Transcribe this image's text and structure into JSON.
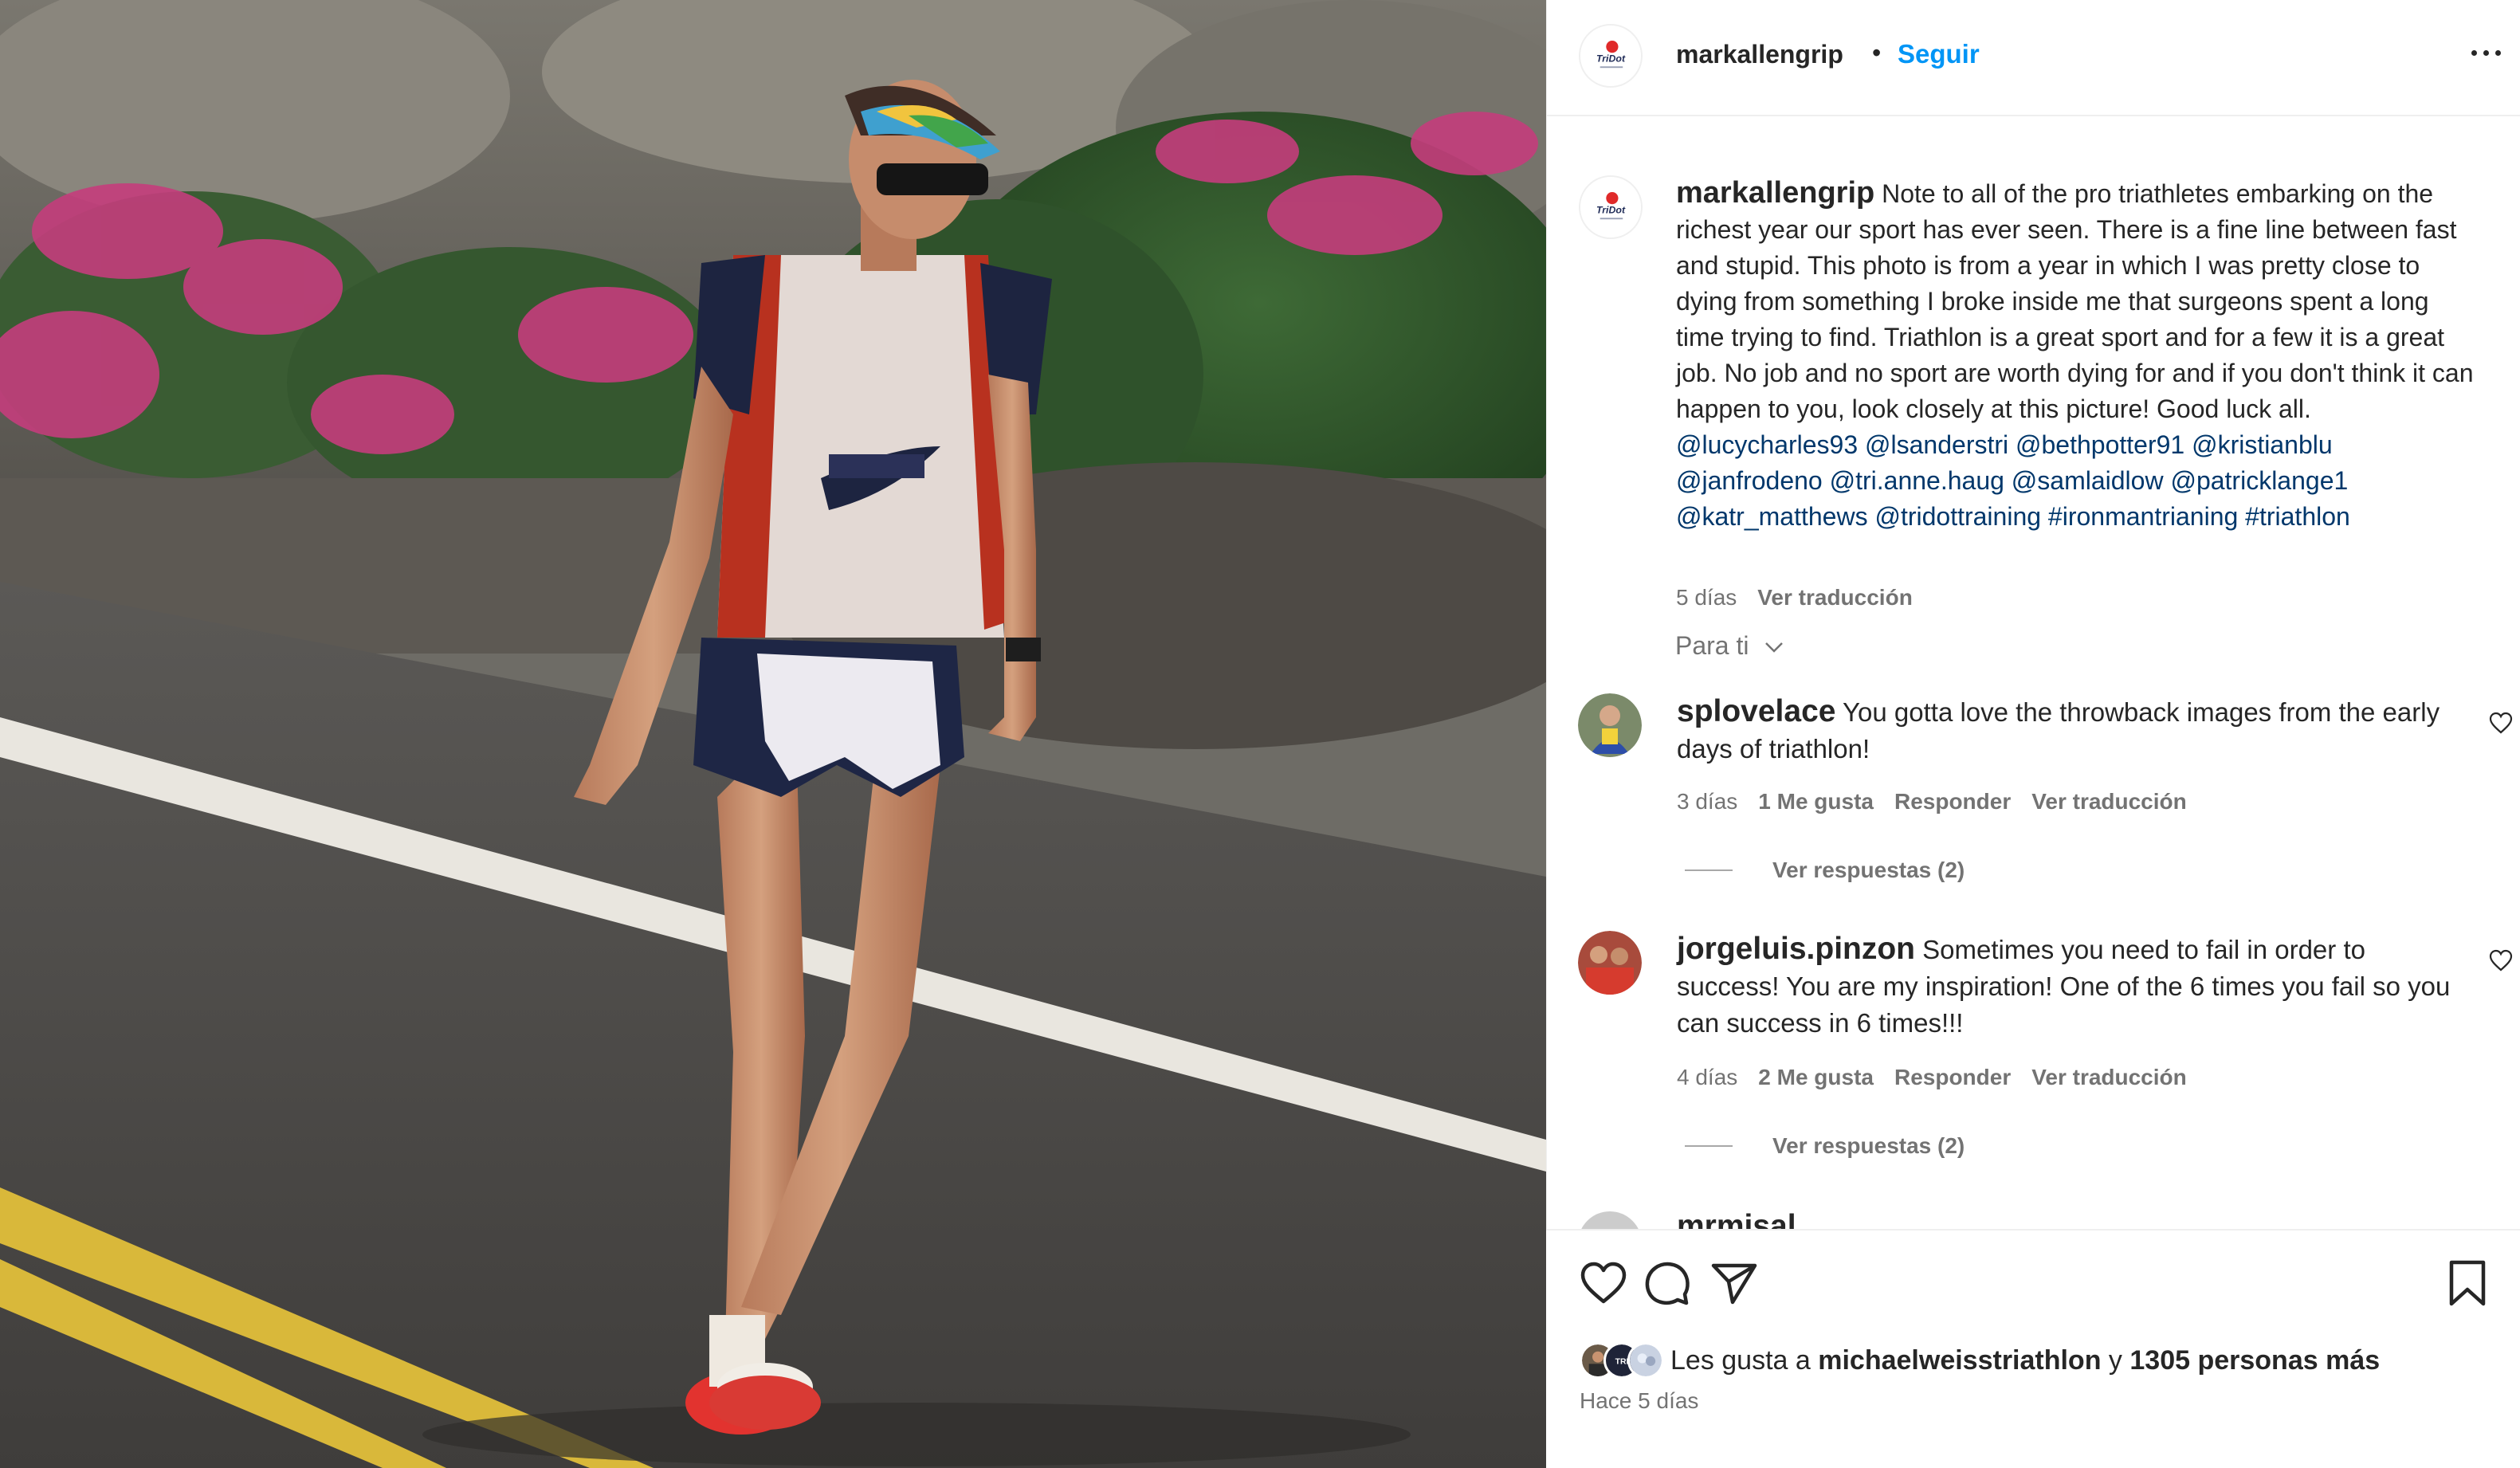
{
  "post": {
    "author": "markallengrip",
    "separator": "•",
    "follow_label": "Seguir",
    "more_icon": "more-horizontal-icon",
    "photo_description_icon": "triathlon-photo",
    "avatar_logo_text": "TriDot"
  },
  "caption": {
    "author": "markallengrip",
    "text": " Note to all of the pro triathletes embarking on the richest year our sport has ever seen. There is a fine line between fast and stupid. This photo is from a year in which I was pretty close to dying from something I broke inside me that surgeons spent a long time trying to find. Triathlon is a great sport and for a few it is a great job. No job and no sport are worth dying for and if you don't think it can happen to you, look closely at this picture! Good luck all. ",
    "tags": [
      "@lucycharles93",
      "@lsanderstri",
      "@bethpotter91",
      "@kristianblu",
      "@janfrodeno",
      "@tri.anne.haug",
      "@samlaidlow",
      "@patricklange1",
      "@katr_matthews",
      "@tridottraining",
      "#ironmantrianing",
      "#triathlon"
    ],
    "time": "5 días",
    "translate": "Ver traducción"
  },
  "filter": {
    "label": "Para ti"
  },
  "comments": [
    {
      "user": "splovelace",
      "text": "You gotta love the throwback images from the early days of triathlon!",
      "time": "3 días",
      "likes": "1 Me gusta",
      "reply": "Responder",
      "translate": "Ver traducción",
      "replies": "Ver respuestas (2)"
    },
    {
      "user": "jorgeluis.pinzon",
      "text": "Sometimes you need to fail in order to success! You are my inspiration! One of the 6 times you fail so you can success in 6 times!!!",
      "time": "4 días",
      "likes": "2 Me gusta",
      "reply": "Responder",
      "translate": "Ver traducción",
      "replies": "Ver respuestas (2)"
    }
  ],
  "partial_comment_user": "mrmisal",
  "actions": {
    "like_icon": "heart-icon",
    "comment_icon": "comment-icon",
    "share_icon": "send-icon",
    "save_icon": "bookmark-icon"
  },
  "likes": {
    "prefix": "Les gusta a ",
    "user": "michaelweisstriathlon",
    "conj": " y ",
    "count": "1305 personas más"
  },
  "posted": "Hace 5 días",
  "colors": {
    "accent": "#0095f6",
    "tag": "#00376b",
    "secondary_text": "#737373"
  }
}
